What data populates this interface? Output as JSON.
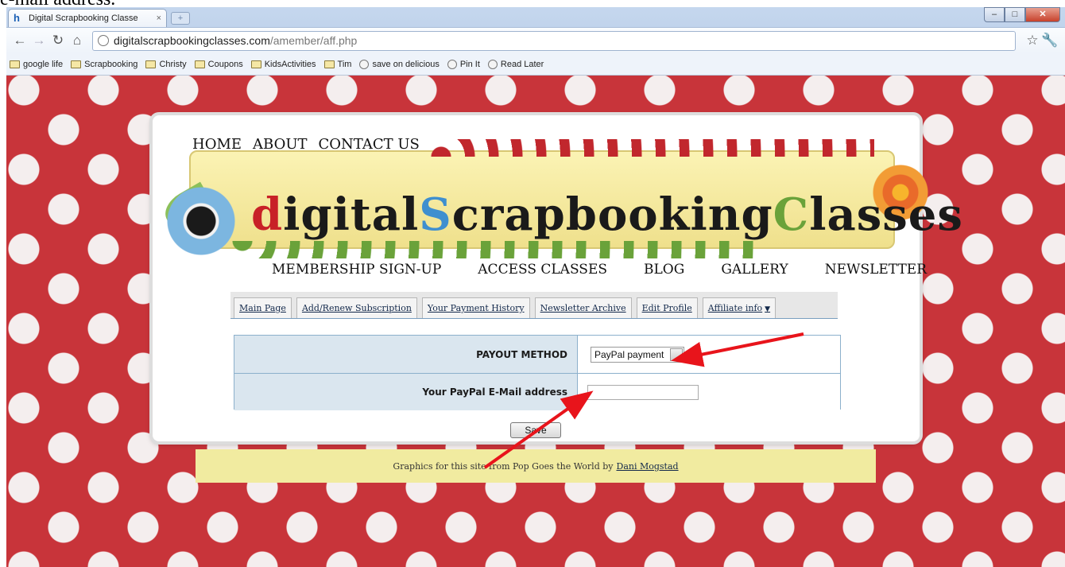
{
  "caption": {
    "text": "e-mail address."
  },
  "browser": {
    "tab_title": "Digital Scrapbooking Classe",
    "tab_close": "×",
    "url_host": "digitalscrapbookingclasses.com",
    "url_path": "/amember/aff.php",
    "bookmarks": [
      {
        "label": "google life",
        "icon": "folder-icon"
      },
      {
        "label": "Scrapbooking",
        "icon": "folder-icon"
      },
      {
        "label": "Christy",
        "icon": "folder-icon"
      },
      {
        "label": "Coupons",
        "icon": "folder-icon"
      },
      {
        "label": "KidsActivities",
        "icon": "folder-icon"
      },
      {
        "label": "Tim",
        "icon": "folder-icon"
      },
      {
        "label": "save on delicious",
        "icon": "globe-icon"
      },
      {
        "label": "Pin It",
        "icon": "globe-icon"
      },
      {
        "label": "Read Later",
        "icon": "globe-icon"
      }
    ]
  },
  "site": {
    "top_nav": [
      "HOME",
      "ABOUT",
      "CONTACT US"
    ],
    "logo": {
      "d": "d",
      "part1": "igital",
      "s": "S",
      "part2": "crapbooking",
      "c": "C",
      "part3": "lasses"
    },
    "bottom_nav": [
      "MEMBERSHIP SIGN-UP",
      "ACCESS CLASSES",
      "BLOG",
      "GALLERY",
      "NEWSLETTER"
    ],
    "member_menu": [
      "Main Page",
      "Add/Renew Subscription",
      "Your Payment History",
      "Newsletter Archive",
      "Edit Profile",
      "Affiliate info"
    ],
    "form": {
      "payout_label": "PAYOUT METHOD",
      "payout_value": "PayPal payment",
      "email_label": "Your PayPal E-Mail address",
      "email_value": "",
      "save_label": "Save"
    },
    "footer": {
      "text": "Graphics for this site from Pop Goes the World by",
      "link": "Dani Mogstad"
    }
  },
  "colors": {
    "page_bg": "#c8343a",
    "dot": "#f4eeee",
    "arrow": "#e8141b",
    "footer_bg": "#f1eba0"
  }
}
